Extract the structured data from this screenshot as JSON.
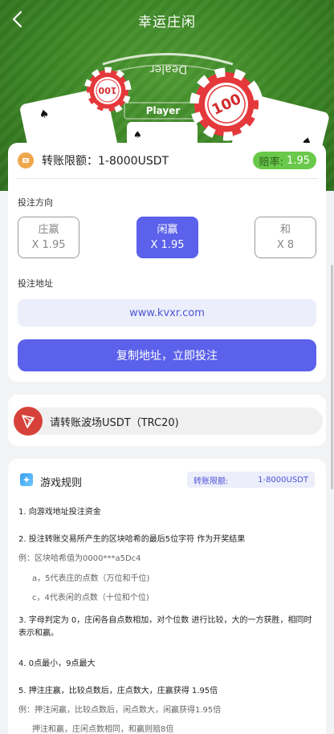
{
  "header": {
    "title": "幸运庄闲"
  },
  "hero": {
    "table_label_dealer": "Dealer",
    "table_label_player": "Player",
    "chip_value_small": "100",
    "chip_value_large": "100"
  },
  "transfer": {
    "limit_text": "转账限额：1-8000USDT",
    "odds_label": "赔率:",
    "odds_value": "1.95",
    "direction_label": "投注方向",
    "options": [
      {
        "name": "庄赢",
        "odds": "X 1.95"
      },
      {
        "name": "闲赢",
        "odds": "X 1.95"
      },
      {
        "name": "和",
        "odds": "X 8"
      }
    ],
    "selected_index": 1,
    "address_label": "投注地址",
    "address": "www.kvxr.com",
    "copy_button": "复制地址，立即投注"
  },
  "trc": {
    "text": "请转账波场USDT（TRC20)"
  },
  "rules": {
    "title": "游戏规则",
    "limit_label": "转账限额:",
    "limit_value": "1-8000USDT",
    "lines": [
      "1. 向游戏地址投注资金",
      "2. 投注转账交易所产生的区块哈希的最后5位字符 作为开奖结果",
      "例：区块哈希值为0000***a5Dc4",
      "a，5代表庄的点数（万位和千位)",
      "c，4代表闲的点数（十位和个位)",
      "3. 字母判定为 0，庄闲各自点数相加，对个位数 进行比较，大的一方获胜，相同时表示和赢。",
      "4. 0点最小，9点最大",
      "5. 押注庄赢，比较点数后，庄点数大，庄赢获得 1.95倍",
      "例：押注闲赢，比较点数后，闲点数大，闲赢获得1.95倍",
      "押注和赢，庄闲点数相同，和赢则赔8倍"
    ]
  },
  "colors": {
    "accent": "#5b61ea",
    "odds_badge": "#69c94a",
    "felt": "#3b8424",
    "tron_red": "#d6423a"
  },
  "icons": {
    "back": "chevron-left-icon",
    "coin": "coin-icon",
    "tron": "tron-logo-icon",
    "rules": "rules-icon"
  }
}
